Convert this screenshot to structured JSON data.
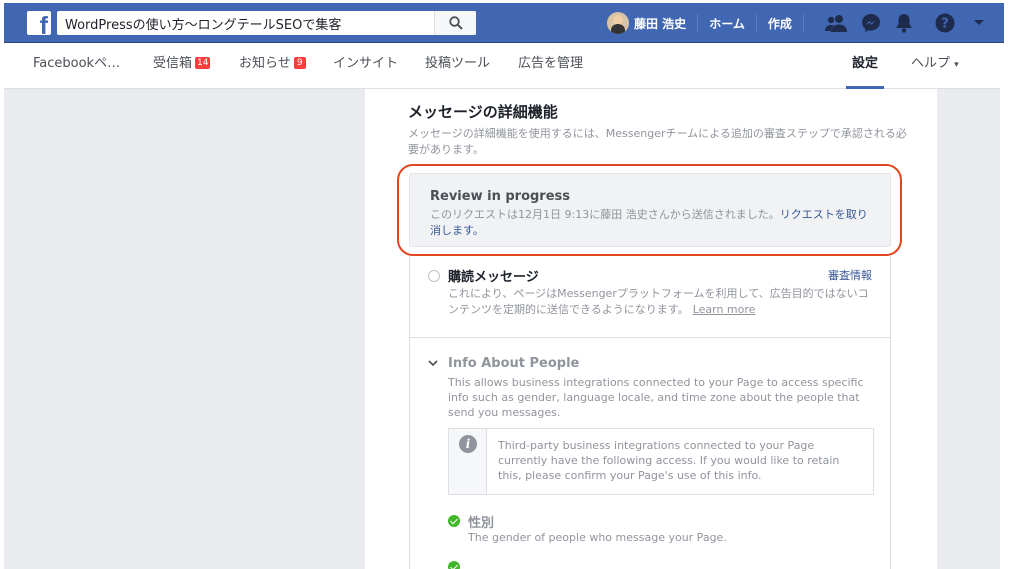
{
  "topbar": {
    "logo_letter": "f",
    "search_value": "WordPressの使い方〜ロングテールSEOで集客",
    "user_name": "藤田 浩史",
    "home_label": "ホーム",
    "create_label": "作成",
    "brand_color": "#4267b2"
  },
  "subnav": {
    "page_name": "Facebookペ…",
    "inbox_label": "受信箱",
    "inbox_count": "14",
    "notifications_label": "お知らせ",
    "notifications_count": "9",
    "insights_label": "インサイト",
    "publishing_tools_label": "投稿ツール",
    "ads_label": "広告を管理",
    "settings_label": "設定",
    "help_label": "ヘルプ",
    "help_caret": "▾"
  },
  "main": {
    "section_title": "メッセージの詳細機能",
    "section_description": "メッセージの詳細機能を使用するには、Messengerチームによる追加の審査ステップで承認される必要があります。",
    "review": {
      "title": "Review in progress",
      "text": "このリクエストは12月1日 9:13に藤田 浩史さんから送信されました。",
      "cancel_link": "リクエストを取り消します。"
    },
    "subscription": {
      "title": "購読メッセージ",
      "review_info_link": "審査情報",
      "description": "これにより、ページはMessengerプラットフォームを利用して、広告目的ではないコンテンツを定期的に送信できるようになります。",
      "learn_more": "Learn more"
    },
    "info_about_people": {
      "title": "Info About People",
      "description": "This allows business integrations connected to your Page to access specific info such as gender, language locale, and time zone about the people that send you messages.",
      "notice_icon": "i",
      "notice": "Third-party business integrations connected to your Page currently have the following access. If you would like to retain this, please confirm your Page's use of this info.",
      "gender_title": "性別",
      "gender_description": "The gender of people who message your Page."
    }
  }
}
